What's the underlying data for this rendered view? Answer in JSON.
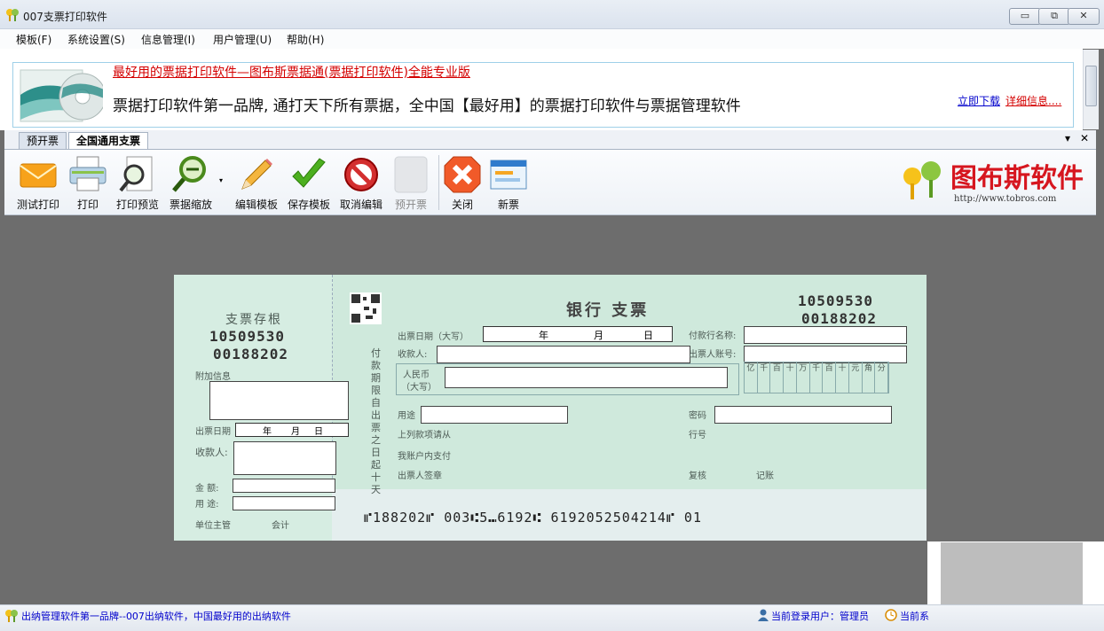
{
  "window": {
    "title": "007支票打印软件",
    "minimize": "▭",
    "restore": "⧉",
    "close": "✕"
  },
  "menu": [
    "模板(F)",
    "系统设置(S)",
    "信息管理(I)",
    "用户管理(U)",
    "帮助(H)"
  ],
  "banner": {
    "headline": "最好用的票据打印软件—图布斯票据通(票据打印软件)全能专业版",
    "slogan": "票据打印软件第一品牌, 通打天下所有票据，全中国【最好用】的票据打印软件与票据管理软件",
    "download": "立即下载",
    "details": "详细信息...."
  },
  "tabs": [
    {
      "label": "预开票",
      "active": false
    },
    {
      "label": "全国通用支票",
      "active": true
    }
  ],
  "tab_controls": {
    "dropdown": "▾",
    "close": "✕"
  },
  "toolbar": {
    "items": [
      {
        "label": "测试打印",
        "icon": "envelope-icon",
        "enabled": true
      },
      {
        "label": "打印",
        "icon": "printer-icon",
        "enabled": true
      },
      {
        "label": "打印预览",
        "icon": "print-preview-icon",
        "enabled": true
      },
      {
        "label": "票据缩放",
        "icon": "zoom-out-icon",
        "enabled": true
      },
      {
        "label": "编辑模板",
        "icon": "pencil-icon",
        "enabled": true
      },
      {
        "label": "保存模板",
        "icon": "checkmark-icon",
        "enabled": true
      },
      {
        "label": "取消编辑",
        "icon": "no-entry-icon",
        "enabled": true
      },
      {
        "label": "预开票",
        "icon": "blank-icon",
        "enabled": false
      },
      {
        "label": "关闭",
        "icon": "close-x-icon",
        "enabled": true
      },
      {
        "label": "新票",
        "icon": "new-window-icon",
        "enabled": true
      }
    ],
    "brand_name": "图布斯软件",
    "brand_url": "http://www.tobros.com"
  },
  "cheque": {
    "stub_title": "支票存根",
    "stub_number1": "10509530",
    "stub_number2": "00188202",
    "stub_extra_label": "附加信息",
    "stub_date_label": "出票日期",
    "stub_payee_label": "收款人:",
    "stub_amount_label": "金 额:",
    "stub_purpose_label": "用 途:",
    "stub_manager_label": "单位主管",
    "stub_accountant_label": "会计",
    "bank_title": "银行  支票",
    "number1": "10509530",
    "number2": "00188202",
    "date_label": "出票日期（大写）",
    "year": "年",
    "month": "月",
    "day": "日",
    "payer_bank_label": "付款行名称:",
    "payee_label": "收款人:",
    "account_label": "出票人账号:",
    "rmb_label": "人民币",
    "rmb_upper": "（大写）",
    "digit_units": [
      "亿",
      "千",
      "百",
      "十",
      "万",
      "千",
      "百",
      "十",
      "元",
      "角",
      "分"
    ],
    "purpose_label": "用途",
    "password_label": "密码",
    "line_no_label": "行号",
    "above_label": "上列款项请从",
    "account_pay_label": "我账户内支付",
    "drawer_sign_label": "出票人签章",
    "review_label": "复核",
    "record_label": "记账",
    "vertical_text": "付款期限自出票之日起十天",
    "micr": "⑈188202⑈ 003⑆5⑉6192⑆ 6192052504214⑈ 01"
  },
  "status": {
    "left": "出纳管理软件第一品牌--007出纳软件，中国最好用的出纳软件",
    "user": "当前登录用户：管理员",
    "time": "当前系"
  }
}
